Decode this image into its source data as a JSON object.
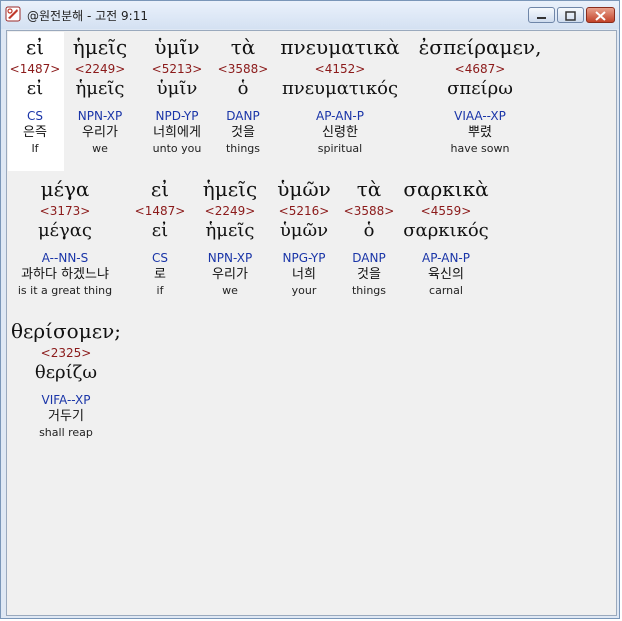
{
  "window": {
    "title": "@원전분해 - 고전 9:11"
  },
  "words": [
    {
      "gk": "εἰ",
      "num": "<1487>",
      "lex": "εἰ",
      "morph": "CS",
      "kor": "은즉",
      "eng": "If"
    },
    {
      "gk": "ἡμεῖς",
      "num": "<2249>",
      "lex": "ἡμεῖς",
      "morph": "NPN-XP",
      "kor": "우리가",
      "eng": "we"
    },
    {
      "gk": "ὑμῖν",
      "num": "<5213>",
      "lex": "ὑμῖν",
      "morph": "NPD-YP",
      "kor": "너희에게",
      "eng": "unto you"
    },
    {
      "gk": "τὰ",
      "num": "<3588>",
      "lex": "ὁ",
      "morph": "DANP",
      "kor": "것을",
      "eng": "things"
    },
    {
      "gk": "πνευματικὰ",
      "num": "<4152>",
      "lex": "πνευματικός",
      "morph": "AP-AN-P",
      "kor": "신령한",
      "eng": "spiritual"
    },
    {
      "gk": "ἐσπείραμεν,",
      "num": "<4687>",
      "lex": "σπείρω",
      "morph": "VIAA--XP",
      "kor": "뿌렸",
      "eng": "have sown"
    },
    {
      "gk": "μέγα",
      "num": "<3173>",
      "lex": "μέγας",
      "morph": "A--NN-S",
      "kor": "과하다 하겠느냐",
      "eng": "is it a great thing"
    },
    {
      "gk": "εἰ",
      "num": "<1487>",
      "lex": "εἰ",
      "morph": "CS",
      "kor": "로",
      "eng": "if"
    },
    {
      "gk": "ἡμεῖς",
      "num": "<2249>",
      "lex": "ἡμεῖς",
      "morph": "NPN-XP",
      "kor": "우리가",
      "eng": "we"
    },
    {
      "gk": "ὑμῶν",
      "num": "<5216>",
      "lex": "ὑμῶν",
      "morph": "NPG-YP",
      "kor": "너희",
      "eng": "your"
    },
    {
      "gk": "τὰ",
      "num": "<3588>",
      "lex": "ὁ",
      "morph": "DANP",
      "kor": "것을",
      "eng": "things"
    },
    {
      "gk": "σαρκικὰ",
      "num": "<4559>",
      "lex": "σαρκικός",
      "morph": "AP-AN-P",
      "kor": "육신의",
      "eng": "carnal"
    },
    {
      "gk": "θερίσομεν;",
      "num": "<2325>",
      "lex": "θερίζω",
      "morph": "VIFA--XP",
      "kor": "거두기",
      "eng": "shall reap"
    }
  ]
}
